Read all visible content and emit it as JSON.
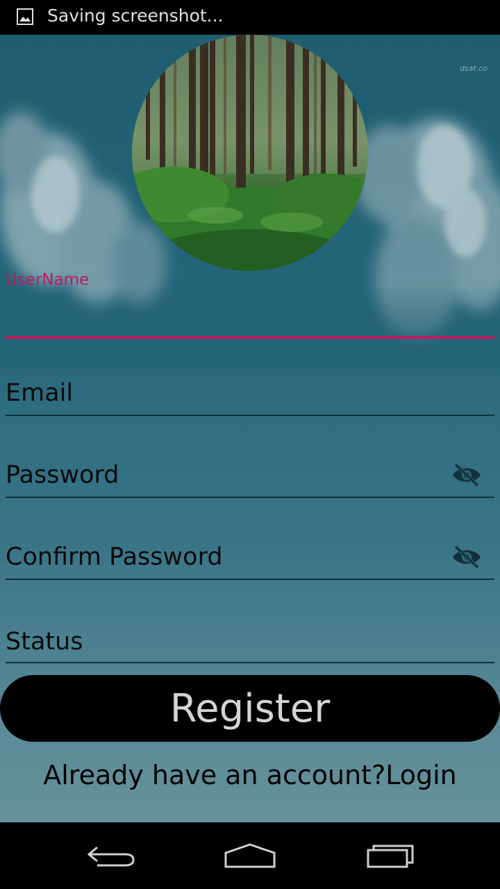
{
  "status_bar": {
    "notification_icon": "image-icon",
    "text": "Saving screenshot..."
  },
  "header": {
    "watermark": "dsat.co",
    "profile_image": "forest-photo"
  },
  "form": {
    "username_label": "UserName",
    "email_label": "Email",
    "password_label": "Password",
    "confirm_password_label": "Confirm Password",
    "status_label": "Status",
    "password_toggle_icon": "eye-off-icon",
    "register_label": "Register",
    "login_text": "Already have an account?Login"
  },
  "colors": {
    "accent": "#c2185b",
    "field_line": "#0f2f3a",
    "text": "#0a0a0a"
  },
  "nav_bar": {
    "back_icon": "back-icon",
    "home_icon": "home-icon",
    "recents_icon": "recents-icon"
  }
}
